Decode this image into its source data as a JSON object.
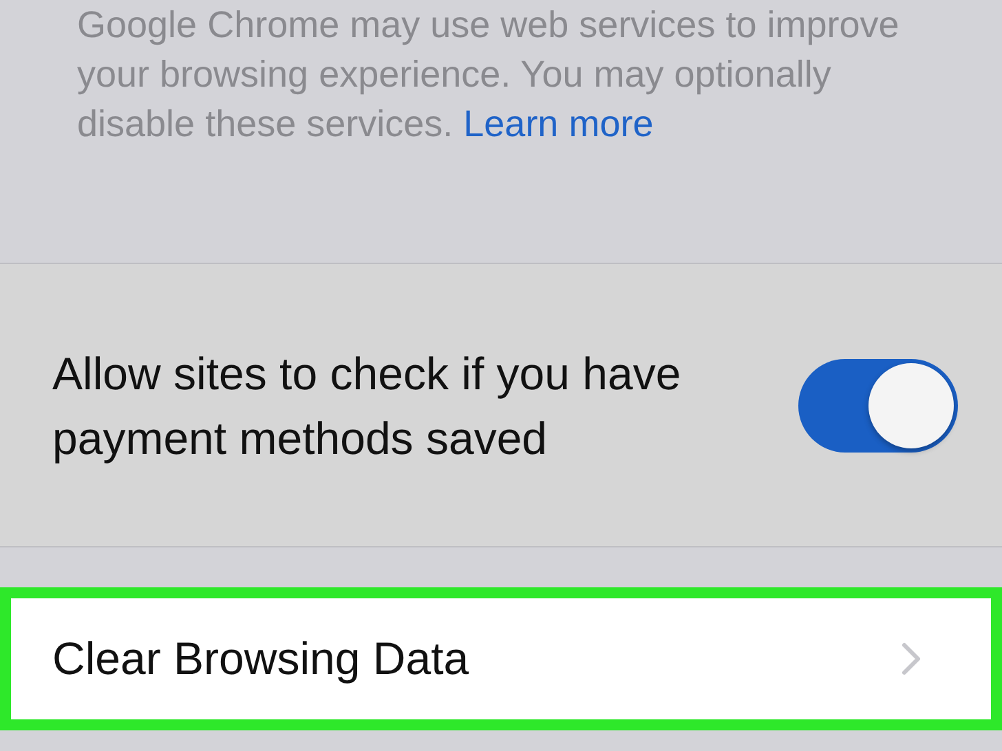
{
  "footer": {
    "text": "Google Chrome may use web services to improve your browsing experience. You may optionally disable these services.",
    "link": "Learn more"
  },
  "toggle_row": {
    "label": "Allow sites to check if you have payment methods saved",
    "on": true
  },
  "nav_row": {
    "label": "Clear Browsing Data",
    "highlighted": true
  }
}
